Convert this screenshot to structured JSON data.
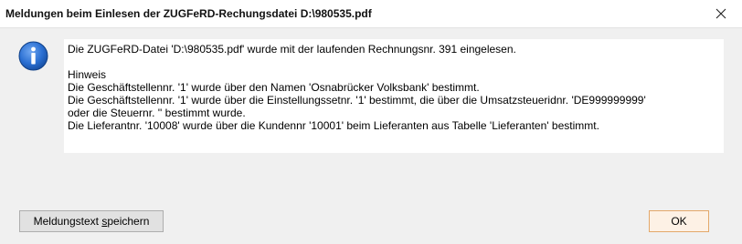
{
  "window": {
    "title": "Meldungen beim Einlesen der ZUGFeRD-Rechungsdatei D:\\980535.pdf",
    "close_icon": "close-icon"
  },
  "message": {
    "icon": "info-icon",
    "lines": [
      "Die ZUGFeRD-Datei 'D:\\980535.pdf' wurde mit der laufenden Rechnungsnr. 391 eingelesen.",
      "",
      "Hinweis",
      "Die Geschäftstellennr. '1' wurde über den Namen 'Osnabrücker Volksbank' bestimmt.",
      "Die Geschäftstellennr. '1' wurde über die Einstellungssetnr. '1' bestimmt, die über die Umsatzsteueridnr. 'DE999999999'",
      "oder die Steuernr. '' bestimmt wurde.",
      "Die Lieferantnr. '10008' wurde über die Kundennr '10001' beim Lieferanten aus Tabelle 'Lieferanten' bestimmt."
    ]
  },
  "buttons": {
    "save_before": "Meldungstext ",
    "save_accel": "s",
    "save_after": "peichern",
    "ok_label": "OK"
  },
  "colors": {
    "ok_border": "#e3a86a",
    "ok_background": "#fdf1e5",
    "info_icon_blue": "#1f5fbf"
  }
}
